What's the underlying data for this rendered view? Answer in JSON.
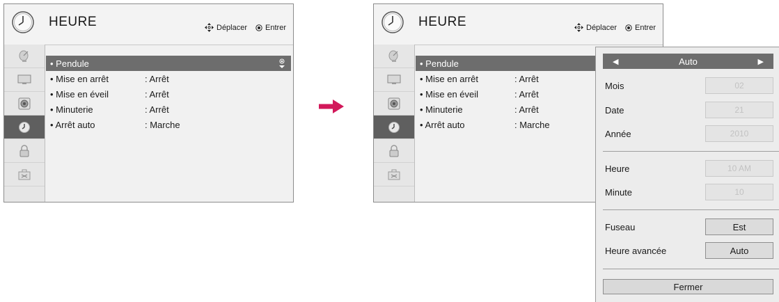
{
  "left": {
    "title": "HEURE",
    "hint_move": "Déplacer",
    "hint_enter": "Entrer",
    "rows": [
      {
        "label": "• Pendule",
        "value": ""
      },
      {
        "label": "• Mise en arrêt",
        "value": ": Arrêt"
      },
      {
        "label": "• Mise en éveil",
        "value": ": Arrêt"
      },
      {
        "label": "• Minuterie",
        "value": ": Arrêt"
      },
      {
        "label": "• Arrêt auto",
        "value": ": Marche"
      }
    ]
  },
  "right": {
    "title": "HEURE",
    "hint_move": "Déplacer",
    "hint_enter": "Entrer",
    "rows": [
      {
        "label": "• Pendule",
        "value": ""
      },
      {
        "label": "• Mise en arrêt",
        "value": ": Arrêt"
      },
      {
        "label": "• Mise en éveil",
        "value": ": Arrêt"
      },
      {
        "label": "• Minuterie",
        "value": ": Arrêt"
      },
      {
        "label": "• Arrêt auto",
        "value": ": Marche"
      }
    ]
  },
  "sidebar_icons": [
    "satellite-dish-icon",
    "monitor-icon",
    "speaker-icon",
    "clock-icon",
    "lock-icon",
    "toolbox-icon"
  ],
  "popup": {
    "mode": "Auto",
    "fields": [
      {
        "label": "Mois",
        "value": "02"
      },
      {
        "label": "Date",
        "value": "21"
      },
      {
        "label": "Année",
        "value": "2010"
      },
      {
        "label": "Heure",
        "value": "10 AM"
      },
      {
        "label": "Minute",
        "value": "10"
      },
      {
        "label": "Fuseau",
        "value": "Est"
      },
      {
        "label": "Heure avancée",
        "value": "Auto"
      }
    ],
    "close_label": "Fermer"
  },
  "colors": {
    "selected_row": "#6d6d6d",
    "active_icon": "#5f5f5f",
    "arrow": "#d2185a"
  }
}
